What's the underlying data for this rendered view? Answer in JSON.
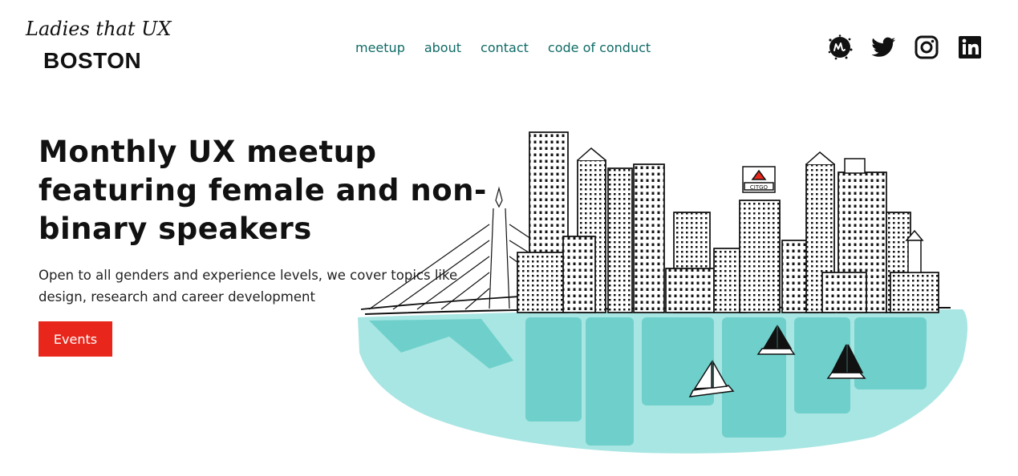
{
  "brand": {
    "script": "Ladies that UX",
    "city": "BOSTON"
  },
  "nav": {
    "items": [
      {
        "label": "meetup"
      },
      {
        "label": "about"
      },
      {
        "label": "contact"
      },
      {
        "label": "code of conduct"
      }
    ]
  },
  "social": {
    "icons": [
      "meetup-icon",
      "twitter-icon",
      "instagram-icon",
      "linkedin-icon"
    ]
  },
  "hero": {
    "title": "Monthly UX meetup featuring female and non-binary speakers",
    "subtitle": "Open to all genders and experience levels, we cover topics like design, research and career development",
    "button_label": "Events"
  },
  "illustration": {
    "sign_text": "CITGO"
  },
  "colors": {
    "nav_link": "#0f6b66",
    "button_bg": "#e8261b",
    "water": "#a8e6e3",
    "water_reflection": "#6fd0cb"
  }
}
